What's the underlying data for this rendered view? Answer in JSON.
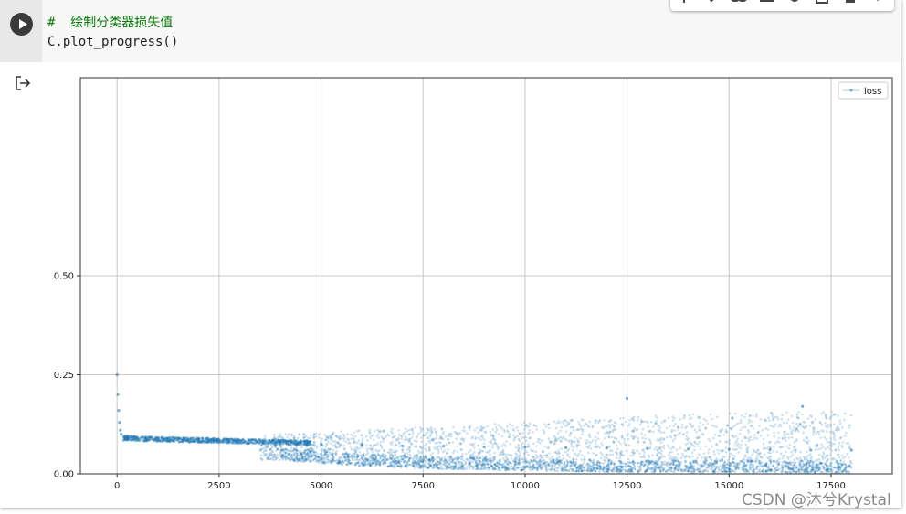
{
  "cell": {
    "comment_line": "#  绘制分类器损失值",
    "code_line": "C.plot_progress()"
  },
  "toolbar": {
    "icons": [
      "move-up-icon",
      "move-down-icon",
      "link-icon",
      "comment-icon",
      "settings-icon",
      "mirror-cell-icon",
      "delete-icon",
      "more-options-icon"
    ]
  },
  "output": {
    "icon": "output-redirect-icon"
  },
  "chart_data": {
    "type": "scatter",
    "title": "",
    "xlabel": "",
    "ylabel": "",
    "xlim": [
      -900,
      19000
    ],
    "ylim": [
      0,
      1.0
    ],
    "xticks": [
      0,
      2500,
      5000,
      7500,
      10000,
      12500,
      15000,
      17500
    ],
    "xtick_labels": [
      "0",
      "2500",
      "5000",
      "7500",
      "10000",
      "12500",
      "15000",
      "17500"
    ],
    "yticks": [
      0.0,
      0.25,
      0.5
    ],
    "ytick_labels": [
      "0.00",
      "0.25",
      "0.50"
    ],
    "grid": true,
    "legend_position": "top-right",
    "color": "#1f77b4",
    "series": [
      {
        "name": "loss",
        "sampled_points": [
          [
            0,
            0.25
          ],
          [
            20,
            0.2
          ],
          [
            40,
            0.16
          ],
          [
            60,
            0.13
          ],
          [
            80,
            0.11
          ],
          [
            100,
            0.1
          ],
          [
            200,
            0.093
          ],
          [
            400,
            0.09
          ],
          [
            1000,
            0.089
          ],
          [
            1500,
            0.088
          ],
          [
            2000,
            0.087
          ],
          [
            2500,
            0.085
          ],
          [
            3000,
            0.084
          ],
          [
            3500,
            0.082
          ],
          [
            4000,
            0.08
          ],
          [
            5000,
            0.075
          ],
          [
            6000,
            0.072
          ],
          [
            7000,
            0.07
          ],
          [
            8000,
            0.07
          ],
          [
            9000,
            0.068
          ],
          [
            10000,
            0.067
          ],
          [
            11000,
            0.066
          ],
          [
            12000,
            0.065
          ],
          [
            12500,
            0.19
          ],
          [
            13000,
            0.064
          ],
          [
            14000,
            0.063
          ],
          [
            15000,
            0.062
          ],
          [
            16000,
            0.061
          ],
          [
            16800,
            0.17
          ],
          [
            17000,
            0.06
          ],
          [
            18000,
            0.06
          ]
        ],
        "envelope": [
          {
            "x": 4000,
            "lower": 0.035,
            "upper": 0.1
          },
          {
            "x": 6000,
            "lower": 0.02,
            "upper": 0.11
          },
          {
            "x": 8000,
            "lower": 0.012,
            "upper": 0.12
          },
          {
            "x": 10000,
            "lower": 0.008,
            "upper": 0.13
          },
          {
            "x": 12000,
            "lower": 0.005,
            "upper": 0.14
          },
          {
            "x": 14000,
            "lower": 0.004,
            "upper": 0.15
          },
          {
            "x": 16000,
            "lower": 0.003,
            "upper": 0.155
          },
          {
            "x": 18000,
            "lower": 0.002,
            "upper": 0.16
          }
        ]
      }
    ]
  },
  "watermark": "CSDN @沐兮Krystal"
}
